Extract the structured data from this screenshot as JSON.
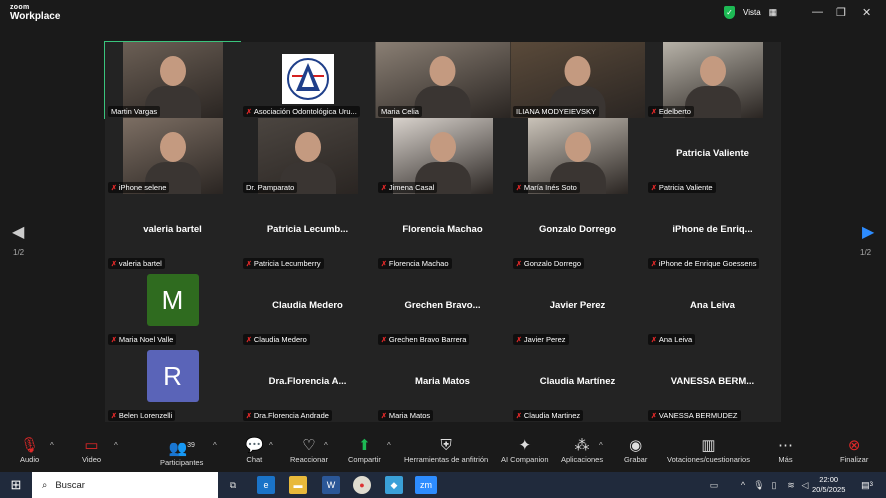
{
  "app": {
    "logo_top": "zoom",
    "logo_bottom": "Workplace",
    "view_label": "Vista"
  },
  "nav": {
    "page_left": "1/2",
    "page_right": "1/2"
  },
  "tiles": [
    {
      "name": "Martin Vargas",
      "kind": "video",
      "vid_color": "#6b5f55",
      "active": true,
      "muted": false
    },
    {
      "name": "Asociación Odontológica Uru...",
      "kind": "logo",
      "muted": true
    },
    {
      "name": "Maria Celia",
      "kind": "video",
      "vid_color": "#8a7f74",
      "muted": false
    },
    {
      "name": "ILIANA MODYEIEVSKY",
      "kind": "video",
      "vid_color": "#5a4a3a",
      "muted": false
    },
    {
      "name": "Edelberto",
      "kind": "video",
      "vid_color": "#b7b2a8",
      "muted": true
    },
    {
      "name": "iPhone selene",
      "kind": "video",
      "vid_color": "#7c6e63",
      "muted": true
    },
    {
      "name": "Dr. Pamparato",
      "kind": "video",
      "vid_color": "#4b4540",
      "muted": false
    },
    {
      "name": "Jimena Casal",
      "kind": "video",
      "vid_color": "#d8d2cc",
      "muted": true
    },
    {
      "name": "María Inés Soto",
      "kind": "video",
      "vid_color": "#c9c2b8",
      "muted": true
    },
    {
      "name": "Patricia Valiente",
      "kind": "name",
      "big": "Patricia Valiente",
      "muted": true
    },
    {
      "name": "valeria bartel",
      "kind": "name",
      "big": "valeria bartel",
      "muted": true
    },
    {
      "name": "Patricia Lecumberry",
      "kind": "name",
      "big": "Patricia  Lecumb...",
      "muted": true
    },
    {
      "name": "Florencia Machao",
      "kind": "name",
      "big": "Florencia Machao",
      "muted": true
    },
    {
      "name": "Gonzalo Dorrego",
      "kind": "name",
      "big": "Gonzalo Dorrego",
      "muted": true
    },
    {
      "name": "iPhone de Enrique Goessens",
      "kind": "name",
      "big": "iPhone  de  Enriq...",
      "muted": true
    },
    {
      "name": "Maria Noel Valle",
      "kind": "avatar",
      "letter": "M",
      "avatar_color": "#2f6b1f",
      "muted": true
    },
    {
      "name": "Claudia Medero",
      "kind": "name",
      "big": "Claudia Medero",
      "muted": true
    },
    {
      "name": "Grechen Bravo Barrera",
      "kind": "name",
      "big": "Grechen  Bravo...",
      "muted": true
    },
    {
      "name": "Javier Perez",
      "kind": "name",
      "big": "Javier Perez",
      "muted": true
    },
    {
      "name": "Ana Leiva",
      "kind": "name",
      "big": "Ana Leiva",
      "muted": true
    },
    {
      "name": "Belen Lorenzelli",
      "kind": "avatar",
      "letter": "R",
      "avatar_color": "#5a64b8",
      "muted": true
    },
    {
      "name": "Dra.Florencia Andrade",
      "kind": "name",
      "big": "Dra.Florencia  A...",
      "muted": true
    },
    {
      "name": "Maria Matos",
      "kind": "name",
      "big": "Maria Matos",
      "muted": true
    },
    {
      "name": "Claudia Martinez",
      "kind": "name",
      "big": "Claudia Martínez",
      "muted": true
    },
    {
      "name": "VANESSA BERMUDEZ",
      "kind": "name",
      "big": "VANESSA  BERM...",
      "muted": true
    }
  ],
  "tile_labels": {
    "t8": "María Inés Soto",
    "t23": "Claudia Martínez"
  },
  "toolbar": {
    "audio": "Audio",
    "video": "Video",
    "participants": "Participantes",
    "participants_count": "39",
    "chat": "Chat",
    "react": "Reaccionar",
    "share": "Compartir",
    "host_tools": "Herramientas de anfitrión",
    "ai": "AI Companion",
    "apps": "Aplicaciones",
    "record": "Grabar",
    "polls": "Votaciones/cuestionarios",
    "more": "Más",
    "end": "Finalizar"
  },
  "taskbar": {
    "search_placeholder": "Buscar",
    "time": "22:00",
    "date": "20/5/2025",
    "notif_count": "3"
  }
}
